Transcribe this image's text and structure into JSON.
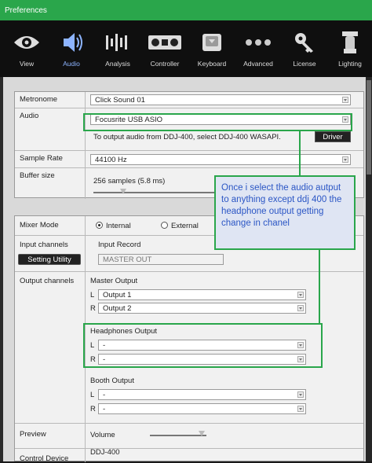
{
  "window": {
    "title": "Preferences"
  },
  "toolbar": {
    "items": [
      {
        "label": "View",
        "icon": "eye-icon",
        "active": false
      },
      {
        "label": "Audio",
        "icon": "speaker-icon",
        "active": true
      },
      {
        "label": "Analysis",
        "icon": "waveform-icon",
        "active": false
      },
      {
        "label": "Controller",
        "icon": "controller-icon",
        "active": false
      },
      {
        "label": "Keyboard",
        "icon": "keyboard-key-icon",
        "active": false
      },
      {
        "label": "Advanced",
        "icon": "three-dots-icon",
        "active": false
      },
      {
        "label": "License",
        "icon": "key-icon",
        "active": false
      },
      {
        "label": "Lighting",
        "icon": "light-fixture-icon",
        "active": false
      }
    ]
  },
  "audio_section": {
    "metronome": {
      "label": "Metronome",
      "value": "Click Sound 01"
    },
    "audio": {
      "label": "Audio",
      "value": "Focusrite USB ASIO",
      "note": "To output audio from DDJ-400, select DDJ-400 WASAPI.",
      "driver_button": "Driver"
    },
    "sample_rate": {
      "label": "Sample Rate",
      "value": "44100 Hz"
    },
    "buffer_size": {
      "label": "Buffer size",
      "value": "256 samples (5.8 ms)"
    }
  },
  "mixer_section": {
    "mixer_mode": {
      "label": "Mixer Mode",
      "internal": "Internal",
      "external": "External",
      "selected": "Internal"
    },
    "input_channels": {
      "label": "Input channels",
      "setting_button": "Setting Utility",
      "input_record_label": "Input Record",
      "input_record_value": "MASTER OUT"
    },
    "output_channels": {
      "label": "Output channels",
      "master_output": {
        "label": "Master Output",
        "l_label": "L",
        "l_value": "Output 1",
        "r_label": "R",
        "r_value": "Output 2"
      },
      "headphones_output": {
        "label": "Headphones Output",
        "l_label": "L",
        "l_value": "-",
        "r_label": "R",
        "r_value": "-"
      },
      "booth_output": {
        "label": "Booth Output",
        "l_label": "L",
        "l_value": "-",
        "r_label": "R",
        "r_value": "-"
      }
    },
    "preview": {
      "label": "Preview",
      "volume_label": "Volume"
    },
    "control_device": {
      "label": "Control Device",
      "value": "DDJ-400"
    }
  },
  "annotation": {
    "text": "Once i select the audio autput to anything except ddj 400 the headphone output getting change in chanel"
  },
  "colors": {
    "accent_green": "#2aa64b",
    "annotation_text": "#2b56c5",
    "active_tab": "#8db4ff"
  }
}
